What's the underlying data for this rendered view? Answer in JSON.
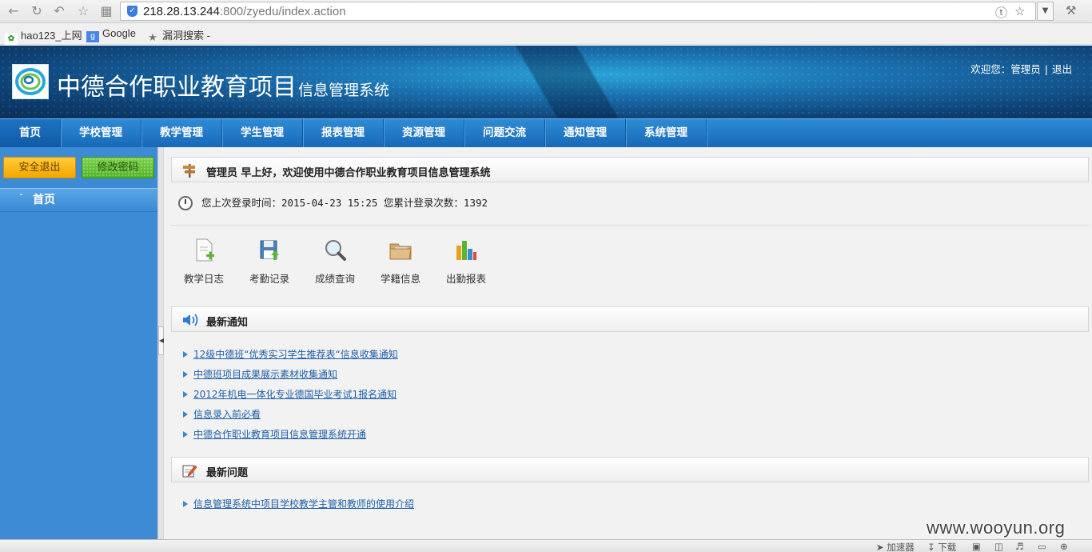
{
  "browser": {
    "url_host": "218.28.13.244",
    "url_rest": ":800/zyedu/index.action",
    "bookmarks": [
      {
        "label": "hao123_上网"
      },
      {
        "label": "Google"
      },
      {
        "label": "漏洞搜索 - "
      }
    ]
  },
  "header": {
    "title": "中德合作职业教育项目",
    "subtitle": "信息管理系统",
    "welcome": "欢迎您：管理员",
    "separator": "|",
    "logout": "退出"
  },
  "nav": {
    "items": [
      {
        "label": "首页"
      },
      {
        "label": "学校管理"
      },
      {
        "label": "教学管理"
      },
      {
        "label": "学生管理"
      },
      {
        "label": "报表管理"
      },
      {
        "label": "资源管理"
      },
      {
        "label": "问题交流"
      },
      {
        "label": "通知管理"
      },
      {
        "label": "系统管理"
      }
    ]
  },
  "sidebar": {
    "exit_label": "安全退出",
    "password_label": "修改密码",
    "menu": [
      {
        "label": "首页"
      }
    ]
  },
  "welcome_panel": {
    "title": "管理员 早上好，欢迎使用中德合作职业教育项目信息管理系统",
    "login_info": "您上次登录时间：2015-04-23 15:25 您累计登录次数：1392"
  },
  "quick_links": [
    {
      "label": "教学日志",
      "icon": "document-add-icon"
    },
    {
      "label": "考勤记录",
      "icon": "floppy-upload-icon"
    },
    {
      "label": "成绩查询",
      "icon": "magnifier-icon"
    },
    {
      "label": "学籍信息",
      "icon": "folder-icon"
    },
    {
      "label": "出勤报表",
      "icon": "bar-chart-icon"
    }
  ],
  "notices": {
    "title": "最新通知",
    "items": [
      {
        "label": "12级中德班“优秀实习学生推荐表“信息收集通知"
      },
      {
        "label": "中德班项目成果展示素材收集通知"
      },
      {
        "label": "2012年机电一体化专业德国毕业考试1报名通知"
      },
      {
        "label": "信息录入前必看"
      },
      {
        "label": "中德合作职业教育项目信息管理系统开通"
      }
    ]
  },
  "questions": {
    "title": "最新问题",
    "items": [
      {
        "label": "信息管理系统中项目学校教学主管和教师的使用介绍"
      }
    ]
  },
  "status_bar": {
    "accelerator": "加速器",
    "download": "下载"
  },
  "watermark": "www.wooyun.org",
  "colors": {
    "nav_blue": "#1f78c8",
    "sidebar_blue": "#3c8bd4",
    "link": "#1f5fa8",
    "exit_button": "#f2a700",
    "password_button": "#4fb322"
  }
}
